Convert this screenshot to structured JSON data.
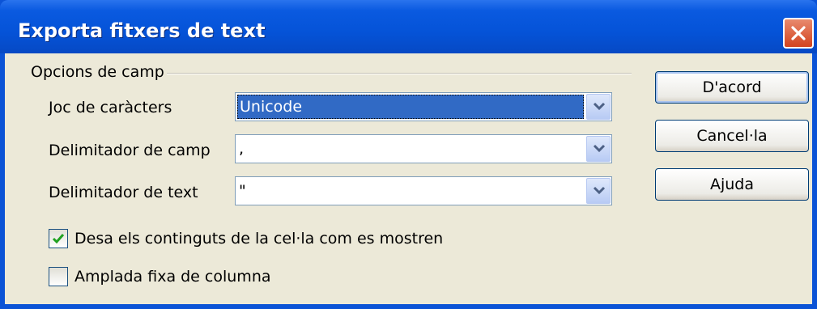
{
  "dialog": {
    "title": "Exporta fitxers de text"
  },
  "group": {
    "label": "Opcions de camp"
  },
  "fields": {
    "charset": {
      "label": "Joc de caràcters",
      "value": "Unicode"
    },
    "field_delimiter": {
      "label": "Delimitador de camp",
      "value": ","
    },
    "text_delimiter": {
      "label": "Delimitador de text",
      "value": "\""
    }
  },
  "options": {
    "save_as_shown": {
      "label": "Desa els continguts de la cel·la com es mostren",
      "checked": true
    },
    "fixed_width": {
      "label": "Amplada fixa de columna",
      "checked": false
    }
  },
  "buttons": {
    "ok": "D'acord",
    "cancel": "Cancel·la",
    "help": "Ajuda"
  }
}
